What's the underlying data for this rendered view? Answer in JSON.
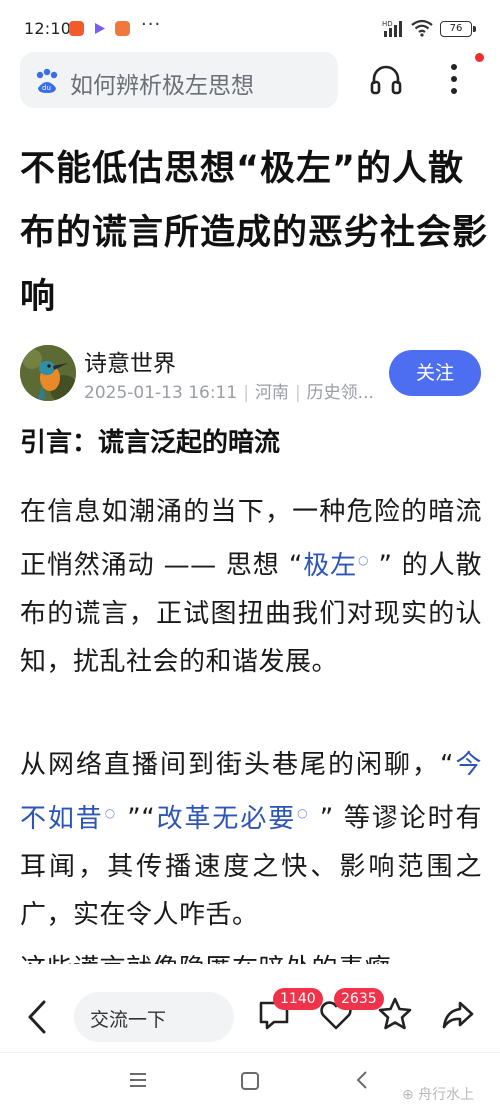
{
  "status": {
    "time": "12:10",
    "more": "···",
    "network": "HD",
    "battery": "76"
  },
  "header": {
    "search_text": "如何辨析极左思想",
    "search_icon": "baidu-paw-icon",
    "listen_icon": "headphones-icon",
    "more_icon": "more-vertical-icon"
  },
  "article": {
    "title": "不能低估思想“极左”的人散布的谎言所造成的恶劣社会影响",
    "author": {
      "name": "诗意世界",
      "date": "2025-01-13 16:11",
      "location": "河南",
      "category": "历史领...",
      "follow_label": "关注"
    },
    "section_heading": "引言：谎言泛起的暗流",
    "paragraphs": {
      "p1_a": "在信息如潮涌的当下，一种危险的暗流正悄然涌动 —— 思想 “",
      "p1_kw": "极左",
      "p1_b": " ” 的人散布的谎言，正试图扭曲我们对现实的认知，扰乱社会的和谐发展。",
      "p2_a": "从网络直播间到街头巷尾的闲聊，“",
      "p2_kw1": "今不如昔",
      "p2_mid": " ”“",
      "p2_kw2": "改革无必要",
      "p2_b": " ” 等谬论时有耳闻，其传播速度之快、影响范围之广，实在令人咋舌。",
      "p3": "这些谎言就像隐匿在暗处的毒瘤，"
    }
  },
  "bottom_bar": {
    "comment_placeholder": "交流一下",
    "comment_count": "1140",
    "like_count": "2635"
  },
  "nav": {
    "watermark": "⊕ 舟行水上"
  },
  "colors": {
    "accent": "#4e6ef2",
    "link": "#2d55b8",
    "badge": "#f0334a"
  }
}
